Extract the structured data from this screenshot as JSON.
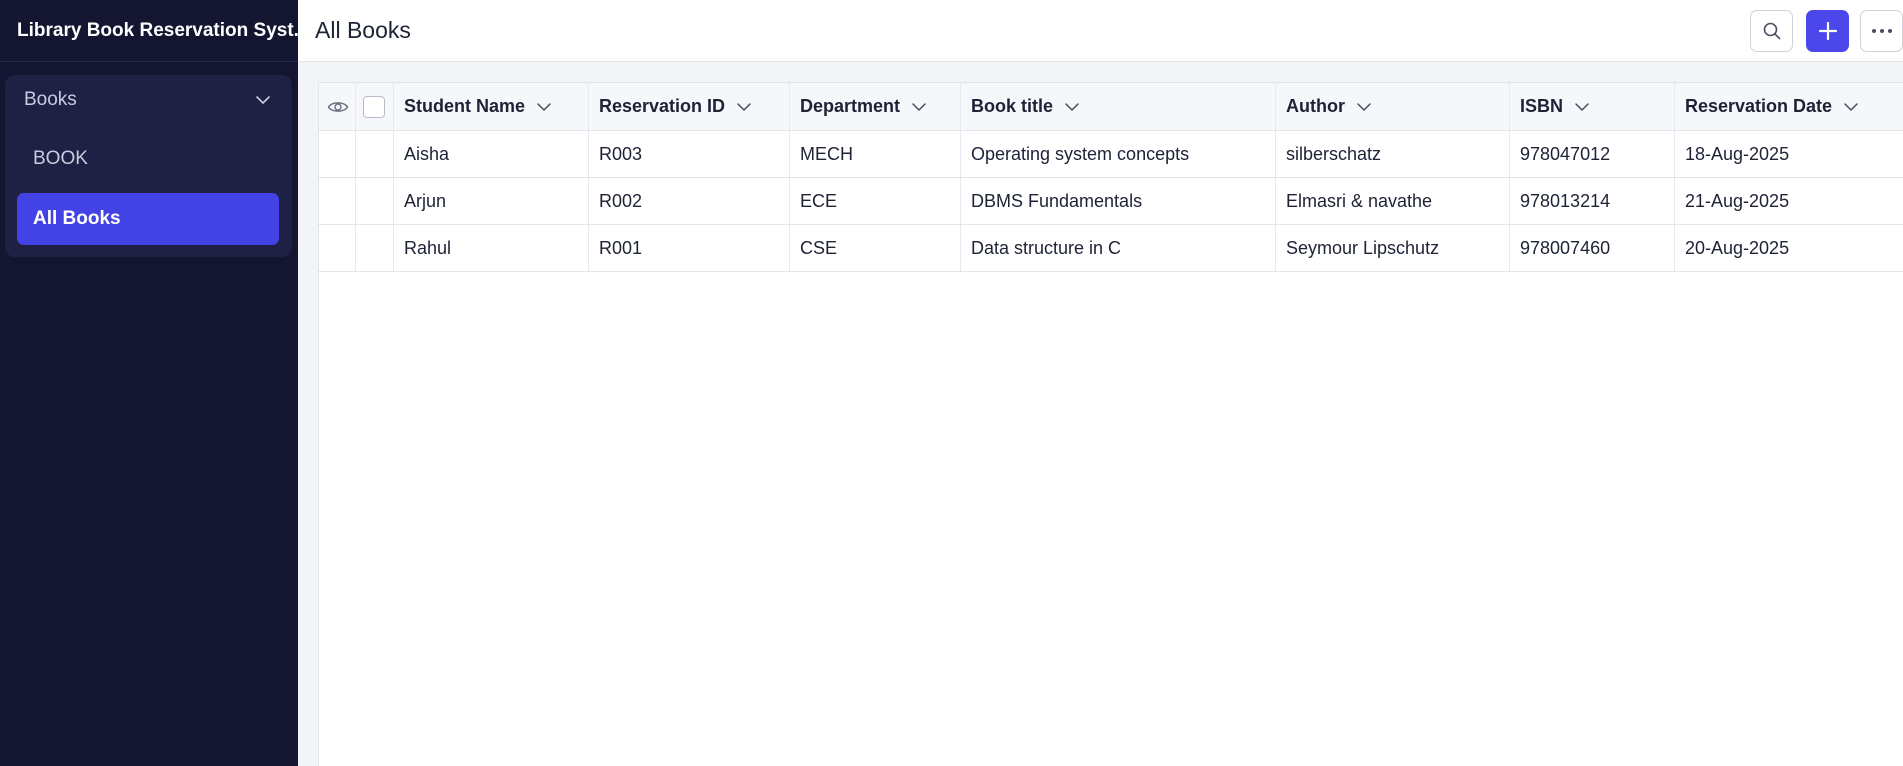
{
  "app": {
    "title": "Library Book Reservation Syst..."
  },
  "sidebar": {
    "group_label": "Books",
    "items": [
      {
        "label": "BOOK"
      },
      {
        "label": "All Books",
        "active": true
      }
    ]
  },
  "header": {
    "title": "All Books",
    "search_icon": "search-icon",
    "add_icon": "plus-icon",
    "more_icon": "more-horizontal-icon"
  },
  "table": {
    "columns": [
      "Student Name",
      "Reservation ID",
      "Department",
      "Book title",
      "Author",
      "ISBN",
      "Reservation Date"
    ],
    "rows": [
      [
        "Aisha",
        "R003",
        "MECH",
        "Operating system concepts",
        "silberschatz",
        "978047012",
        "18-Aug-2025"
      ],
      [
        "Arjun",
        "R002",
        "ECE",
        "DBMS Fundamentals",
        "Elmasri & navathe",
        "978013214",
        "21-Aug-2025"
      ],
      [
        "Rahul",
        "R001",
        "CSE",
        "Data structure in C",
        "Seymour Lipschutz",
        "978007460",
        "20-Aug-2025"
      ]
    ]
  },
  "colors": {
    "sidebar_bg": "#141530",
    "accent": "#4b47ea",
    "active_item": "#4343e5"
  }
}
